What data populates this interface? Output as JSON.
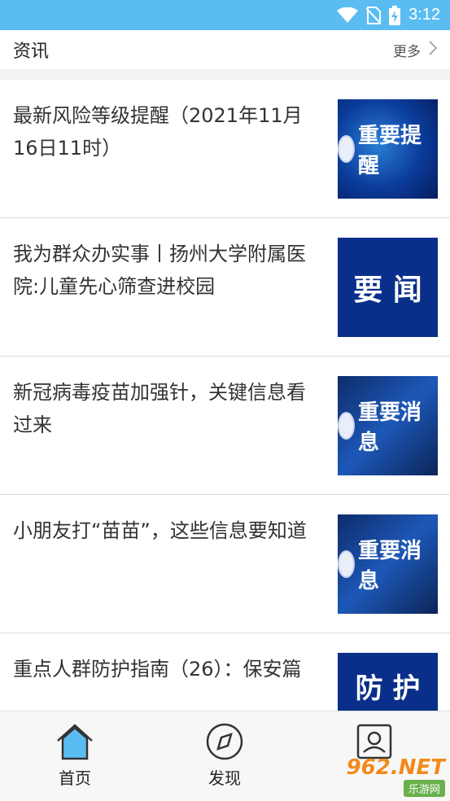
{
  "status_bar": {
    "time": "3:12"
  },
  "section": {
    "title": "资讯",
    "more_label": "更多"
  },
  "news": [
    {
      "title": "最新风险等级提醒（2021年11月16日11时）",
      "thumb_text": "重要提醒"
    },
    {
      "title": "我为群众办实事丨扬州大学附属医院:儿童先心筛查进校园",
      "thumb_text": "要 闻"
    },
    {
      "title": "新冠病毒疫苗加强针，关键信息看过来",
      "thumb_text": "重要消息"
    },
    {
      "title": "小朋友打“苗苗”，这些信息要知道",
      "thumb_text": "重要消息"
    },
    {
      "title": "重点人群防护指南（26）：保安篇",
      "thumb_text": "防 护"
    }
  ],
  "tabbar": {
    "items": [
      {
        "label": "首页",
        "icon": "home-icon"
      },
      {
        "label": "发现",
        "icon": "compass-icon"
      },
      {
        "label": "",
        "icon": "profile-icon"
      }
    ]
  },
  "watermark": {
    "brand": "962.NET",
    "sub": "乐游网"
  },
  "colors": {
    "status_bar": "#5bbcf2",
    "tab_active": "#5bbcf2"
  }
}
